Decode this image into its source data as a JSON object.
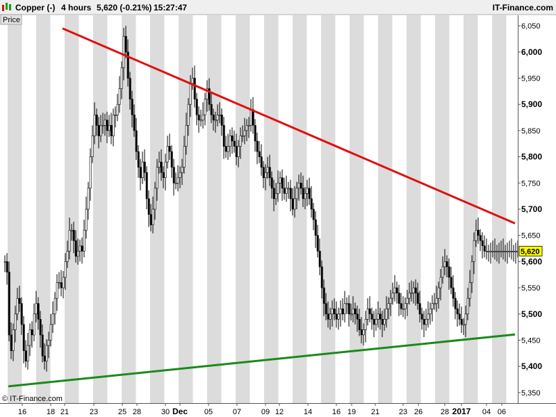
{
  "header": {
    "instrument": "Copper (-)",
    "timeframe": "4 hours",
    "quote": "5,620 (-0.21%)",
    "time": "15:27:47",
    "brand": "IT-Finance.com",
    "price_tab": "Price",
    "copyright": "© IT-Finance.com",
    "last_price_label": "5,620"
  },
  "colors": {
    "resistance": "#e01010",
    "support": "#1a8a1a",
    "candle": "#000000",
    "band": "#dcdcdc",
    "last_price_box": "#ffff00"
  },
  "chart_data": {
    "type": "candlestick",
    "ylim": [
      5330,
      6070
    ],
    "y_ticks": [
      5350,
      5400,
      5450,
      5500,
      5550,
      5600,
      5650,
      5700,
      5750,
      5800,
      5850,
      5900,
      5950,
      6000,
      6050
    ],
    "y_tick_labels": [
      "5,350",
      "5,400",
      "5,450",
      "5,500",
      "5,550",
      "5,600",
      "5,650",
      "5,700",
      "5,750",
      "5,800",
      "5,850",
      "5,900",
      "5,950",
      "6,000",
      "6,050"
    ],
    "x_ticks": [
      "16",
      "18",
      "21",
      "23",
      "25",
      "28",
      "30",
      "Dec",
      "05",
      "07",
      "09",
      "12",
      "14",
      "16",
      "19",
      "21",
      "23",
      "26",
      "28",
      "2017",
      "04",
      "06"
    ],
    "x_bold_ticks": [
      "Dec",
      "2017"
    ],
    "last_price": 5620,
    "grid": false,
    "series": [
      {
        "name": "Copper",
        "bars": 247,
        "close": [
          5600,
          5580,
          5460,
          5430,
          5470,
          5500,
          5530,
          5520,
          5480,
          5430,
          5410,
          5440,
          5470,
          5460,
          5500,
          5520,
          5490,
          5460,
          5420,
          5410,
          5440,
          5450,
          5480,
          5500,
          5530,
          5560,
          5560,
          5550,
          5570,
          5600,
          5620,
          5660,
          5660,
          5640,
          5610,
          5620,
          5630,
          5620,
          5660,
          5700,
          5740,
          5800,
          5840,
          5880,
          5860,
          5840,
          5860,
          5860,
          5870,
          5850,
          5860,
          5840,
          5880,
          5880,
          5900,
          5930,
          5970,
          6030,
          6000,
          5950,
          5910,
          5880,
          5850,
          5810,
          5780,
          5760,
          5790,
          5770,
          5720,
          5690,
          5670,
          5700,
          5740,
          5780,
          5790,
          5770,
          5760,
          5790,
          5820,
          5810,
          5780,
          5750,
          5750,
          5760,
          5770,
          5780,
          5820,
          5860,
          5900,
          5940,
          5950,
          5910,
          5880,
          5870,
          5870,
          5880,
          5910,
          5930,
          5900,
          5880,
          5870,
          5870,
          5880,
          5880,
          5860,
          5820,
          5810,
          5820,
          5840,
          5830,
          5820,
          5800,
          5820,
          5840,
          5840,
          5850,
          5860,
          5860,
          5890,
          5860,
          5830,
          5810,
          5800,
          5780,
          5760,
          5770,
          5780,
          5760,
          5740,
          5720,
          5730,
          5750,
          5760,
          5740,
          5730,
          5740,
          5740,
          5720,
          5700,
          5720,
          5740,
          5750,
          5740,
          5720,
          5730,
          5740,
          5720,
          5700,
          5680,
          5650,
          5620,
          5590,
          5550,
          5520,
          5500,
          5490,
          5500,
          5510,
          5500,
          5490,
          5500,
          5510,
          5500,
          5520,
          5520,
          5500,
          5500,
          5510,
          5500,
          5490,
          5470,
          5460,
          5470,
          5490,
          5510,
          5500,
          5490,
          5480,
          5490,
          5500,
          5490,
          5480,
          5490,
          5510,
          5520,
          5530,
          5540,
          5550,
          5540,
          5520,
          5510,
          5510,
          5520,
          5530,
          5540,
          5540,
          5550,
          5540,
          5520,
          5500,
          5490,
          5480,
          5490,
          5500,
          5510,
          5520,
          5520,
          5530,
          5550,
          5570,
          5590,
          5600,
          5590,
          5570,
          5550,
          5530,
          5510,
          5500,
          5490,
          5480,
          5480,
          5500,
          5530,
          5560,
          5600,
          5640,
          5660,
          5650,
          5640,
          5630,
          5620,
          5620,
          5620,
          5620,
          5620,
          5620,
          5620,
          5620,
          5620,
          5620,
          5620,
          5620,
          5620,
          5620,
          5620,
          5620,
          5620
        ]
      }
    ],
    "trendlines": [
      {
        "name": "",
        "from": [
          28,
          6045
        ],
        "to": [
          246,
          5675
        ]
      },
      {
        "name": "",
        "from": [
          2,
          5362
        ],
        "to": [
          246,
          5461
        ]
      }
    ]
  }
}
